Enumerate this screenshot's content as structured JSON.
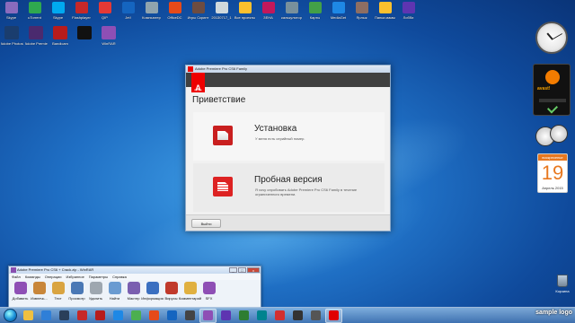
{
  "desktop": {
    "row1_icons": [
      {
        "label": "Skype",
        "icon": "app-icon",
        "color": "#8a6bbd"
      },
      {
        "label": "uTorrent",
        "icon": "torrent-icon",
        "color": "#2fa84f"
      },
      {
        "label": "Skype",
        "icon": "skype-icon",
        "color": "#00a9f0"
      },
      {
        "label": "Flashplayer",
        "icon": "flash-icon",
        "color": "#c62828"
      },
      {
        "label": "QIP",
        "icon": "qip-icon",
        "color": "#e53935"
      },
      {
        "label": "Jet!",
        "icon": "app-icon",
        "color": "#1565c0"
      },
      {
        "label": "Компьютер",
        "icon": "computer-icon",
        "color": "#90a4ae"
      },
      {
        "label": "OfficeDC",
        "icon": "office-icon",
        "color": "#e64a19"
      },
      {
        "label": "Игры Скрипт",
        "icon": "games-icon",
        "color": "#6d4c41"
      },
      {
        "label": "20130717_1",
        "icon": "file-icon",
        "color": "#cfd8dc"
      },
      {
        "label": "Все проекты",
        "icon": "folder-icon",
        "color": "#fbc02d"
      },
      {
        "label": "ЗЕНА",
        "icon": "app-icon",
        "color": "#c2185b"
      },
      {
        "label": "калькулятор",
        "icon": "calculator-icon",
        "color": "#78909c"
      },
      {
        "label": "Карты",
        "icon": "maps-icon",
        "color": "#43a047"
      },
      {
        "label": "MediaGet",
        "icon": "mediaget-icon",
        "color": "#1e88e5"
      },
      {
        "label": "Ярлык",
        "icon": "shortcut-icon",
        "color": "#8d6e63"
      },
      {
        "label": "Папка мамы",
        "icon": "folder-icon",
        "color": "#fbc02d"
      },
      {
        "label": "Лобби",
        "icon": "app-icon",
        "color": "#5e35b1"
      }
    ],
    "row2_icons": [
      {
        "label": "Adobe Photosh...",
        "icon": "photoshop-icon",
        "color": "#1a3d6e"
      },
      {
        "label": "Adobe Premiere Pro...",
        "icon": "premiere-icon",
        "color": "#4a2a6e"
      },
      {
        "label": "Bandicam",
        "icon": "bandicam-icon",
        "color": "#b71c1c"
      },
      {
        "label": "",
        "icon": "black-square-icon",
        "color": "#111111"
      },
      {
        "label": "WinRAR",
        "icon": "winrar-icon",
        "color": "#8e4fb5"
      }
    ],
    "gadgets": {
      "avast_name": "avast!",
      "calendar_weekday": "воскресенье",
      "calendar_day": "19",
      "calendar_month": "Апрель 2015"
    },
    "recycle_bin_label": "Корзина"
  },
  "adobe_dialog": {
    "title": "Adobe Premiere Pro CS6 Family",
    "logo_text": "A",
    "logo_sub": "Adobe",
    "welcome": "Приветствие",
    "install": {
      "title": "Установка",
      "desc": "У меня есть серийный номер."
    },
    "trial": {
      "title": "Пробная версия",
      "desc": "Я хочу опробовать Adobe Premiere Pro CS6 Family в течение ограниченного времени."
    },
    "exit_label": "Выйти"
  },
  "winrar": {
    "title": "Adobe Premiere Pro CS6 + Crack.zip - WinRAR",
    "menu": [
      "Файл",
      "Команды",
      "Операции",
      "Избранное",
      "Параметры",
      "Справка"
    ],
    "tools": [
      {
        "label": "Добавить",
        "icon": "add-icon",
        "color": "#8e4fb5"
      },
      {
        "label": "Извлечь...",
        "icon": "extract-icon",
        "color": "#c8863a"
      },
      {
        "label": "Тест",
        "icon": "test-icon",
        "color": "#d9a441"
      },
      {
        "label": "Просмотр",
        "icon": "view-icon",
        "color": "#4a78b5"
      },
      {
        "label": "Удалить",
        "icon": "delete-icon",
        "color": "#9ea7b0"
      },
      {
        "label": "Найти",
        "icon": "find-icon",
        "color": "#6a9bd1"
      },
      {
        "label": "Мастер",
        "icon": "wizard-icon",
        "color": "#7a5fb0"
      },
      {
        "label": "Информация",
        "icon": "info-icon",
        "color": "#3a6fc0"
      },
      {
        "label": "Вирусы",
        "icon": "virus-icon",
        "color": "#c0392b"
      },
      {
        "label": "Комментарий",
        "icon": "comment-icon",
        "color": "#e0b040"
      },
      {
        "label": "SFX",
        "icon": "sfx-icon",
        "color": "#8e4fb5"
      }
    ],
    "window_buttons": {
      "min": "_",
      "max": "□",
      "close": "x"
    }
  },
  "taskbar": {
    "items": [
      {
        "icon": "explorer-icon",
        "color": "#f0c040"
      },
      {
        "icon": "media-icon",
        "color": "#2f7fd8"
      },
      {
        "icon": "steam-icon",
        "color": "#2a3f5a"
      },
      {
        "icon": "flash-icon",
        "color": "#c62828"
      },
      {
        "icon": "bandicam-icon",
        "color": "#b71c1c"
      },
      {
        "icon": "app-icon",
        "color": "#1e88e5"
      },
      {
        "icon": "chrome-icon",
        "color": "#4caf50"
      },
      {
        "icon": "app-icon",
        "color": "#e64a19"
      },
      {
        "icon": "word-icon",
        "color": "#1565c0"
      },
      {
        "icon": "app-icon",
        "color": "#444444"
      },
      {
        "icon": "winrar-icon",
        "color": "#8e4fb5"
      },
      {
        "icon": "app-icon",
        "color": "#5e35b1"
      },
      {
        "icon": "app-icon",
        "color": "#2e7d32"
      },
      {
        "icon": "app-icon",
        "color": "#00838f"
      },
      {
        "icon": "opera-icon",
        "color": "#d32f2f"
      },
      {
        "icon": "app-icon",
        "color": "#333333"
      },
      {
        "icon": "app-icon",
        "color": "#555555"
      },
      {
        "icon": "adobe-icon",
        "color": "#e00000"
      }
    ],
    "watermark": "sample logo"
  }
}
